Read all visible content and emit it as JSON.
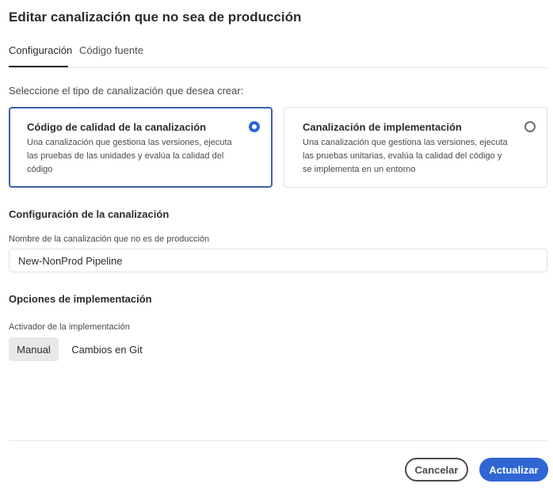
{
  "dialog": {
    "title": "Editar canalización que no sea de producción"
  },
  "tabs": [
    {
      "label": "Configuración",
      "active": true
    },
    {
      "label": "Código fuente",
      "active": false
    }
  ],
  "pipeline_type": {
    "prompt": "Seleccione el tipo de canalización que desea crear:",
    "options": [
      {
        "title": "Código de calidad de la canalización",
        "description": "Una canalización que gestiona las versiones, ejecuta las pruebas de las unidades y evalúa la calidad del código",
        "selected": true
      },
      {
        "title": "Canalización de implementación",
        "description": "Una canalización que gestiona las versiones, ejecuta las pruebas unitarias, evalúa la calidad del código y se implementa en un entorno",
        "selected": false
      }
    ]
  },
  "pipeline_config": {
    "heading": "Configuración de la canalización",
    "name_label": "Nombre de la canalización que no es de producción",
    "name_value": "New-NonProd Pipeline"
  },
  "deployment": {
    "heading": "Opciones de implementación",
    "trigger_label": "Activador de la implementación",
    "triggers": [
      {
        "label": "Manual",
        "selected": true
      },
      {
        "label": "Cambios en Git",
        "selected": false
      }
    ]
  },
  "footer": {
    "cancel_label": "Cancelar",
    "update_label": "Actualizar"
  },
  "colors": {
    "accent": "#2f66d3",
    "selected_border": "#3b63a8",
    "divider": "#e1e1e1"
  }
}
